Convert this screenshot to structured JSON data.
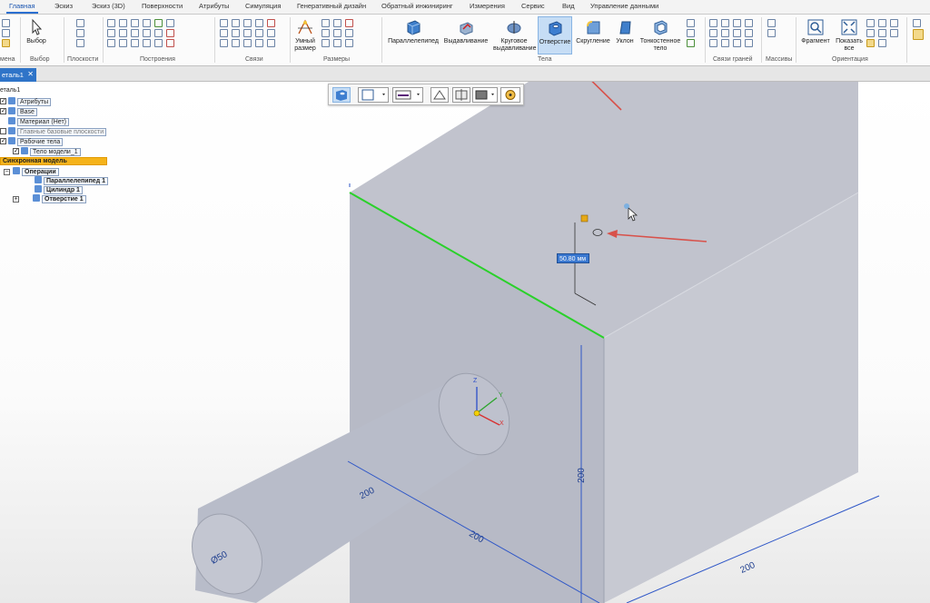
{
  "menu": {
    "tabs": [
      "Главная",
      "Эскиз",
      "Эскиз (3D)",
      "Поверхности",
      "Атрибуты",
      "Симуляция",
      "Генеративный дизайн",
      "Обратный инжиниринг",
      "Измерения",
      "Сервис",
      "Вид",
      "Управление данными"
    ],
    "active": "Главная"
  },
  "ribbon": {
    "groups": {
      "change": "мена",
      "select": "Выбор",
      "planes": "Плоскости",
      "build": "Построения",
      "links": "Связи",
      "sizes": "Размеры",
      "bodies": "Тела",
      "face_links": "Связи граней",
      "arrays": "Массивы",
      "orientation": "Ориентация"
    },
    "buttons": {
      "select": "Выбор",
      "smart_dimension": "Умный размер",
      "parallelepiped": "Параллелепипед",
      "extrude": "Выдавливание",
      "revolve_l1": "Круговое",
      "revolve_l2": "выдавливание",
      "hole": "Отверстие",
      "round": "Скругление",
      "draft": "Уклон",
      "thin_wall_l1": "Тонкостенное",
      "thin_wall_l2": "тело",
      "fragment": "Фрагмент",
      "fit_l1": "Показать",
      "fit_l2": "все"
    }
  },
  "document": {
    "tab": "еталь1",
    "close": "✕"
  },
  "tree": {
    "root": "еталь1",
    "attributes": "Атрибуты",
    "base": "Base",
    "material": "Материал (Нет)",
    "main_planes": "Главные базовые плоскости",
    "work_bodies": "Рабочие тела",
    "model_body": "Тело модели_1",
    "sync_model": "Синхронная модель",
    "operations": "Операции",
    "op_parallelepiped": "Параллелепипед 1",
    "op_cylinder": "Цилиндр 1",
    "op_hole": "Отверстие 1"
  },
  "viewport": {
    "dim_input": "50.80 мм",
    "dim_height": "200",
    "dim_width": "200",
    "dim_depth": "200",
    "dim_cyl_len": "200",
    "dim_cyl_dia": "Ø50",
    "axis_z": "Z",
    "axis_y": "Y",
    "axis_x": "X",
    "colors": {
      "box_left": "#b7bac6",
      "box_right": "#c7c9d2",
      "box_top": "#c1c3cd",
      "selected_edge": "#2ad12a",
      "dim_line": "#2f57c7",
      "arrow": "#d8514a"
    }
  }
}
